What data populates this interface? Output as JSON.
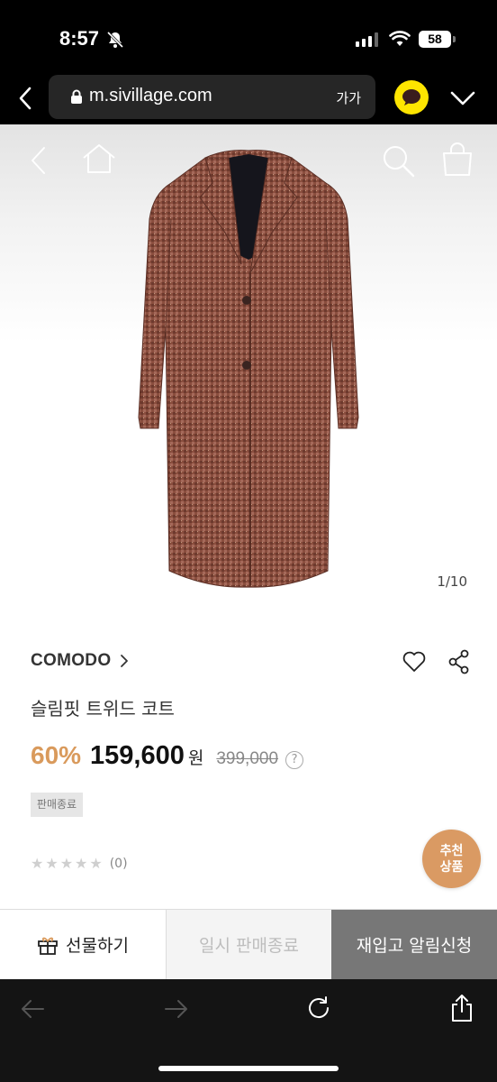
{
  "status_bar": {
    "time": "8:57",
    "battery": "58",
    "icons": [
      "bell-slash-icon",
      "cellular-signal-icon",
      "wifi-icon",
      "battery-icon"
    ]
  },
  "browser": {
    "url": "m.sivillage.com",
    "text_size_label": "가가",
    "icons": [
      "back-chevron-icon",
      "lock-icon",
      "kakao-talk-icon",
      "chevron-down-icon"
    ]
  },
  "gallery": {
    "counter": "1/10",
    "icons": [
      "back-arrow-icon",
      "home-icon",
      "search-icon",
      "shopping-bag-icon"
    ],
    "coat_color": "#8a4e3e"
  },
  "product": {
    "brand": "COMODO",
    "brand_arrow": "›",
    "name": "슬림핏 트위드 코트",
    "discount": "60%",
    "price": "159,600",
    "currency": "원",
    "original_price": "399,000",
    "help_label": "?",
    "status_badge": "판매종료",
    "rating_stars": [
      "★",
      "★",
      "★",
      "★",
      "★"
    ],
    "review_count": "(0)"
  },
  "recommend": {
    "line1": "추천",
    "line2": "상품"
  },
  "actions": {
    "gift_label": "선물하기",
    "soldout_label": "일시 판매종료",
    "restock_label": "재입고 알림신청"
  },
  "colors": {
    "accent": "#d99a5c",
    "recommend_bg": "#da9a63",
    "restock_bg": "#777777",
    "kakao_yellow": "#fee500"
  }
}
